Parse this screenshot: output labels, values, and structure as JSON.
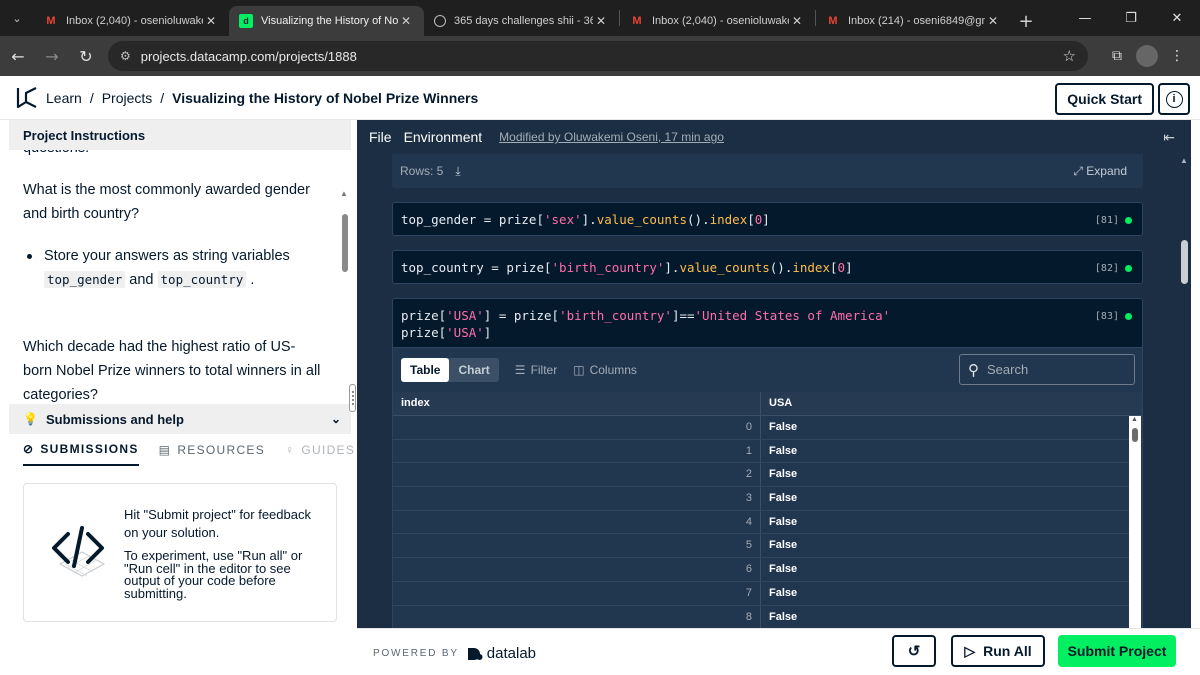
{
  "browser": {
    "tabs": [
      {
        "title": "Inbox (2,040) - osenioluwake",
        "favicon": "gmail-icon",
        "active": false
      },
      {
        "title": "Visualizing the History of No",
        "favicon": "datacamp-icon",
        "active": true
      },
      {
        "title": "365 days challenges shii - 36",
        "favicon": "chatgpt-icon",
        "active": false
      },
      {
        "title": "Inbox (2,040) - osenioluwake",
        "favicon": "gmail-icon",
        "active": false
      },
      {
        "title": "Inbox (214) - oseni6849@gm",
        "favicon": "gmail-icon",
        "active": false
      }
    ],
    "url": "projects.datacamp.com/projects/1888"
  },
  "header": {
    "crumbs": [
      "Learn",
      "Projects"
    ],
    "title": "Visualizing the History of Nobel Prize Winners",
    "quick_start": "Quick Start"
  },
  "instructions": {
    "header": "Project Instructions",
    "cut_line": "questions:",
    "q1": "What is the most commonly awarded gender and birth country?",
    "bullet_prefix": "Store your answers as string variables",
    "code1": "top_gender",
    "and": "and",
    "code2": "top_country",
    "bullet_suffix": ".",
    "q2": "Which decade had the highest ratio of US-born Nobel Prize winners to total winners in all categories?"
  },
  "submissions": {
    "header": "Submissions and help",
    "tabs": [
      "SUBMISSIONS",
      "RESOURCES",
      "GUIDES"
    ],
    "text1": "Hit \"Submit project\" for feedback on your solution.",
    "text2": "To experiment, use \"Run all\" or \"Run cell\" in the editor to see output of your code before submitting."
  },
  "notebook": {
    "menu": [
      "File",
      "Environment"
    ],
    "modified": "Modified by Oluwakemi Oseni, 17 min ago",
    "rows_label": "Rows: 5",
    "expand": "Expand",
    "cells": [
      {
        "num": "[81]"
      },
      {
        "num": "[82]"
      },
      {
        "num": "[83]"
      }
    ],
    "output": {
      "view_tabs": [
        "Table",
        "Chart"
      ],
      "filter": "Filter",
      "columns": "Columns",
      "search_placeholder": "Search",
      "col_index": "index",
      "col_usa": "USA",
      "rows": [
        {
          "i": "0",
          "v": "False"
        },
        {
          "i": "1",
          "v": "False"
        },
        {
          "i": "2",
          "v": "False"
        },
        {
          "i": "3",
          "v": "False"
        },
        {
          "i": "4",
          "v": "False"
        },
        {
          "i": "5",
          "v": "False"
        },
        {
          "i": "6",
          "v": "False"
        },
        {
          "i": "7",
          "v": "False"
        },
        {
          "i": "8",
          "v": "False"
        }
      ]
    }
  },
  "footer": {
    "powered": "POWERED BY",
    "brand": "datalab",
    "run_all": "Run All",
    "submit": "Submit Project"
  }
}
